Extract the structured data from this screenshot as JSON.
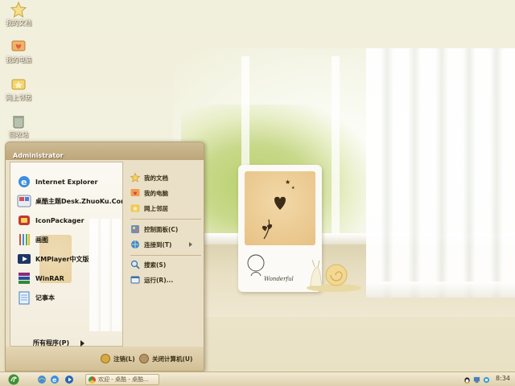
{
  "desktop": {
    "icons": [
      {
        "label": "我的文档",
        "icon": "star-folder-icon"
      },
      {
        "label": "我的电脑",
        "icon": "computer-heart-icon"
      },
      {
        "label": "网上邻居",
        "icon": "network-places-icon"
      },
      {
        "label": "回收站",
        "icon": "recycle-bin-icon"
      }
    ]
  },
  "wallpaper": {
    "polaroid_caption": "Wonderful"
  },
  "start_menu": {
    "username": "Administrator",
    "pinned": [
      {
        "label": "Internet Explorer",
        "icon": "internet-explorer-icon"
      },
      {
        "label": "桌酷主题Desk.ZhuoKu.Com",
        "icon": "zhuoku-theme-icon"
      },
      {
        "label": "IconPackager",
        "icon": "iconpackager-icon"
      },
      {
        "label": "画图",
        "icon": "paint-icon"
      },
      {
        "label": "KMPlayer中文版",
        "icon": "kmplayer-icon"
      },
      {
        "label": "WinRAR",
        "icon": "winrar-icon"
      },
      {
        "label": "记事本",
        "icon": "notepad-icon"
      }
    ],
    "all_programs": "所有程序(P)",
    "places": [
      {
        "label": "我的文档",
        "icon": "star-folder-icon"
      },
      {
        "label": "我的电脑",
        "icon": "computer-heart-icon"
      },
      {
        "label": "网上邻居",
        "icon": "network-places-icon"
      }
    ],
    "system": [
      {
        "label": "控制面板(C)",
        "icon": "control-panel-icon"
      },
      {
        "label": "连接到(T)",
        "icon": "connect-to-icon",
        "submenu": true
      }
    ],
    "tools": [
      {
        "label": "搜索(S)",
        "icon": "search-icon"
      },
      {
        "label": "运行(R)...",
        "icon": "run-icon"
      }
    ],
    "logoff": "注销(L)",
    "shutdown": "关闭计算机(U)"
  },
  "taskbar": {
    "task_label": "欢迎 - 桌酷 - 桌酷...",
    "clock": "8:34",
    "colors": {
      "accent": "#bda67a",
      "taskbar": "#e6dab9"
    }
  }
}
